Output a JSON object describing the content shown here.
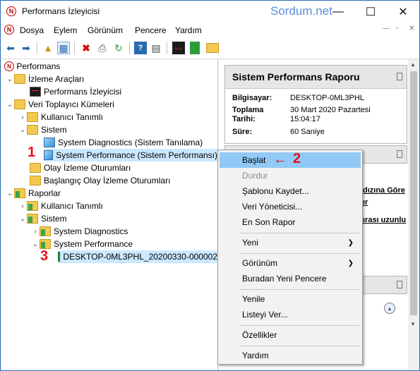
{
  "window": {
    "title": "Performans İzleyicisi",
    "watermark": "Sordum.net",
    "minimize_glyph": "—",
    "maximize_glyph": "☐",
    "close_glyph": "✕"
  },
  "menubar": {
    "items": [
      "Dosya",
      "Eylem",
      "Görünüm",
      "Pencere",
      "Yardım"
    ],
    "mdi_controls": [
      "—",
      "▫",
      "✕"
    ]
  },
  "toolbar": {
    "icons": [
      "back-icon",
      "forward-icon",
      "up-folder-icon",
      "show-hide-console-tree-icon",
      "delete-icon",
      "print-icon",
      "refresh-icon",
      "help-icon",
      "properties-icon",
      "performance-monitor-icon",
      "report-icon",
      "folder-icon"
    ]
  },
  "tree": {
    "root": "Performans",
    "monitoring_tools": "İzleme Araçları",
    "performance_monitor": "Performans İzleyicisi",
    "data_collector_sets": "Veri Toplayıcı Kümeleri",
    "user_defined": "Kullanıcı Tanımlı",
    "system": "Sistem",
    "system_diagnostics": "System Diagnostics (Sistem Tanılama)",
    "system_performance": "System Performance (Sistem Performansı)",
    "event_trace_sessions": "Olay İzleme Oturumları",
    "startup_event_trace": "Başlangıç Olay İzleme Oturumları",
    "reports": "Raporlar",
    "reports_user_defined": "Kullanıcı Tanımlı",
    "reports_system": "Sistem",
    "reports_system_diagnostics": "System Diagnostics",
    "reports_system_performance": "System Performance",
    "report_item": "DESKTOP-0ML3PHL_20200330-000002"
  },
  "annotations": {
    "num1": "1",
    "num2": "2",
    "num3": "3",
    "arrow": "←"
  },
  "report": {
    "title": "Sistem Performans Raporu",
    "computer_label": "Bilgisayar:",
    "computer_value": "DESKTOP-0ML3PHL",
    "collection_label_1": "Toplama",
    "collection_label_2": "Tarihi:",
    "date_value": "30 Mart 2020 Pazartesi",
    "time_value": "15:04:17",
    "duration_label": "Süre:",
    "duration_value": "60 Saniye",
    "fragment_1": "dızına Göre",
    "fragment_2": "ır",
    "fragment_3": "ırası uzunlu"
  },
  "context_menu": {
    "start": "Başlat",
    "stop": "Durdur",
    "save_template": "Şablonu Kaydet...",
    "data_manager": "Veri Yöneticisi...",
    "latest_report": "En Son Rapor",
    "new": "Yeni",
    "view": "Görünüm",
    "new_window_from_here": "Buradan Yeni Pencere",
    "refresh": "Yenile",
    "export_list": "Listeyi Ver...",
    "properties": "Özellikler",
    "help": "Yardım"
  },
  "colors": {
    "accent_red": "#e8101a",
    "selection": "#cce8ff",
    "menu_highlight": "#91c9f7"
  }
}
